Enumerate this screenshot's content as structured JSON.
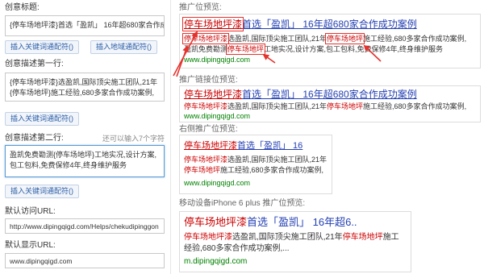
{
  "left": {
    "title_label": "创意标题:",
    "title_value": "{停车场地坪漆}首选「盈凯」 16年超680家合作成",
    "insert_keyword_btn": "插入关键词通配符()",
    "insert_region_btn": "插入地域通配符()",
    "desc1_label": "创意描述第一行:",
    "desc1_value": "{停车场地坪漆}选盈凯,国际顶尖施工团队,21年{停车场地坪}施工经验,680多家合作成功案例,",
    "desc2_label": "创意描述第二行:",
    "desc2_hint": "还可以输入7个字符",
    "desc2_value": "盈凯免费勘测{停车场地坪}工地实况,设计方案,包工包料,免费保修4年,终身维护服务",
    "visit_url_label": "默认访问URL:",
    "visit_url_value": "http://www.dipingqigd.com/Helps/chekudipinggon",
    "display_url_label": "默认显示URL:",
    "display_url_value": "www.dipingqigd.com"
  },
  "previews": {
    "main": {
      "label": "推广位预览:",
      "title": [
        "停车场地坪漆",
        "首选「盈凯」 16年超680家合作成功案例"
      ],
      "desc_line1": [
        "停车场地坪漆",
        "选盈凯,国际顶尖施工团队,21年",
        "停车场地坪",
        "施工经验,680多家合作成功案例,"
      ],
      "desc_line2": [
        "盈凯免费勘测",
        "停车场地坪",
        "工地实况,设计方案,包工包料,免费保修4年,终身维护服务"
      ],
      "url": "www.dipingqigd.com"
    },
    "link": {
      "label": "推广链接位预览:",
      "title": [
        "停车场地坪漆",
        "首选「盈凯」 16年超680家合作成功案例"
      ],
      "desc": [
        "停车场地坪漆",
        "选盈凯,国际顶尖施工团队,21年",
        "停车场地坪",
        "施工经验,680多家合作成功案例,"
      ],
      "url": "www.dipingqigd.com"
    },
    "right": {
      "label": "右侧推广位预览:",
      "title": [
        "停车场地坪漆",
        "首选「盈凯」 16"
      ],
      "desc_line1": [
        "停车场地坪漆",
        "选盈凯,国际顶尖施工团队,21年"
      ],
      "desc_line2": [
        "停车场地坪",
        "施工经验,680多家合作成功案例,"
      ],
      "url": "www.dipingqigd.com"
    },
    "mobile": {
      "label": "移动设备iPhone 6 plus 推广位预览:",
      "title": [
        "停车场地坪漆",
        "首选「盈凯」 16年超6.."
      ],
      "desc_line1": [
        "停车场地坪漆",
        "选盈凯,国际顶尖施工团队,21年",
        "停车场地坪",
        "施工"
      ],
      "desc_line2": [
        "经验,680多家合作成功案例,..."
      ],
      "url": "m.dipingqigd.com"
    }
  },
  "colors": {
    "title_link": "#2440b3",
    "keyword": "#cc0000",
    "display_url": "#008000",
    "annotation": "#e5322d",
    "focus_border": "#5b9bd5"
  }
}
